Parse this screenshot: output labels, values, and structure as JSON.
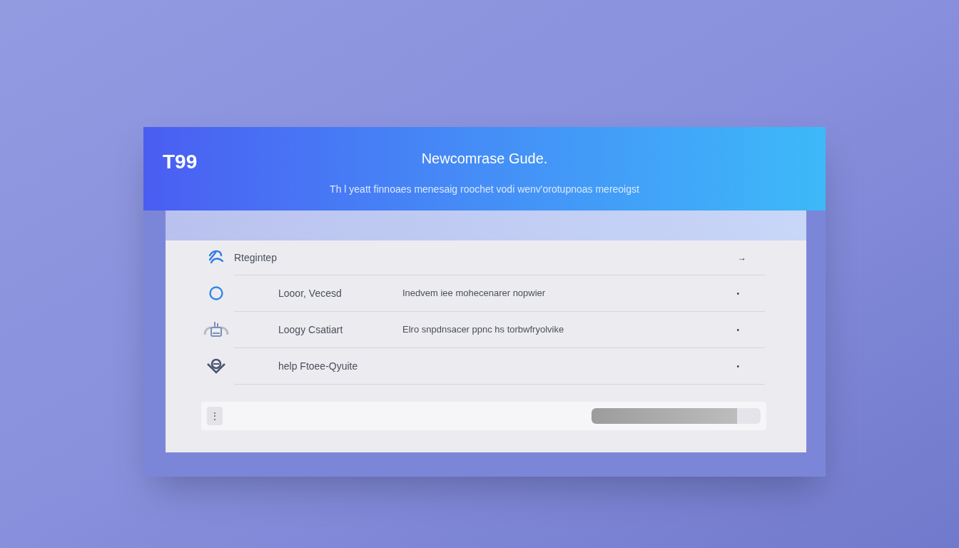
{
  "header": {
    "logo": "T99",
    "title": "Newcomrase Gude.",
    "subtitle": "Th l yeatt finnoaes menesaig roochet vodi wenv'orotupnoas mereoigst"
  },
  "list": {
    "heading": {
      "label": "Rtegintep",
      "arrow": "→"
    },
    "rows": [
      {
        "title": "Looor, Vecesd",
        "description": "Inedvem iee mohecenarer nopwier",
        "mark": "•"
      },
      {
        "title": "Loogy Csatiart",
        "description": "Elro snpdnsacer ppnc hs torbwfryolvike",
        "mark": "•"
      },
      {
        "title": "help Ftoee-Qyuite",
        "mark": "•"
      }
    ]
  },
  "footer": {
    "handle": "⋮",
    "progress": {
      "level": 0.86
    }
  }
}
